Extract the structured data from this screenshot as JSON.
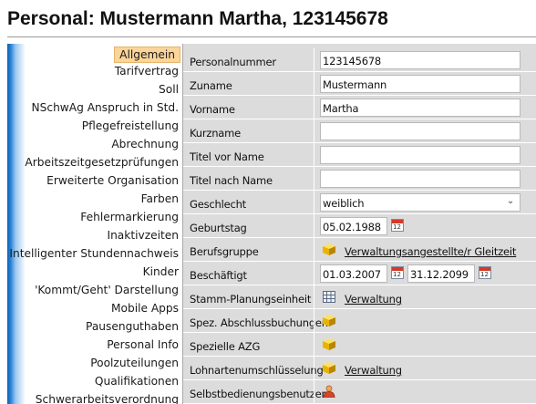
{
  "window": {
    "title": "Personal: Mustermann Martha, 123145678"
  },
  "sidebar": {
    "items": [
      {
        "label": "Allgemein",
        "active": true
      },
      {
        "label": "Tarifvertrag"
      },
      {
        "label": "Soll"
      },
      {
        "label": "NSchwAg Anspruch in Std."
      },
      {
        "label": "Pflegefreistellung"
      },
      {
        "label": "Abrechnung"
      },
      {
        "label": "Arbeitszeitgesetzprüfungen"
      },
      {
        "label": "Erweiterte Organisation"
      },
      {
        "label": "Farben"
      },
      {
        "label": "Fehlermarkierung"
      },
      {
        "label": "Inaktivzeiten"
      },
      {
        "label": "Intelligenter Stundennachweis"
      },
      {
        "label": "Kinder"
      },
      {
        "label": "'Kommt/Geht' Darstellung"
      },
      {
        "label": "Mobile Apps"
      },
      {
        "label": "Pausenguthaben"
      },
      {
        "label": "Personal Info"
      },
      {
        "label": "Poolzuteilungen"
      },
      {
        "label": "Qualifikationen"
      },
      {
        "label": "Schwerarbeitsverordnung"
      }
    ]
  },
  "form": {
    "personalnummer": {
      "label": "Personalnummer",
      "value": "123145678"
    },
    "zuname": {
      "label": "Zuname",
      "value": "Mustermann"
    },
    "vorname": {
      "label": "Vorname",
      "value": "Martha"
    },
    "kurzname": {
      "label": "Kurzname",
      "value": ""
    },
    "titel_vor": {
      "label": "Titel vor Name",
      "value": ""
    },
    "titel_nach": {
      "label": "Titel nach Name",
      "value": ""
    },
    "geschlecht": {
      "label": "Geschlecht",
      "value": "weiblich"
    },
    "geburtstag": {
      "label": "Geburtstag",
      "value": "05.02.1988"
    },
    "berufsgruppe": {
      "label": "Berufsgruppe",
      "link": "Verwaltungsangestellte/r Gleitzeit"
    },
    "beschaeftigt": {
      "label": "Beschäftigt",
      "from": "01.03.2007",
      "to": "31.12.2099"
    },
    "stamm_planungseinheit": {
      "label": "Stamm-Planungseinheit",
      "link": "Verwaltung"
    },
    "spez_abschlussbuchungen": {
      "label": "Spez. Abschlussbuchungen"
    },
    "spezielle_azg": {
      "label": "Spezielle AZG"
    },
    "lohnartenumschluesselung": {
      "label": "Lohnartenumschlüsselung",
      "link": "Verwaltung"
    },
    "selbstbedienungsbenutzer": {
      "label": "Selbstbedienungsbenutzer"
    }
  },
  "icons": {
    "calendar": "calendar-icon",
    "cube": "cube-icon",
    "grid": "grid-icon",
    "user": "user-icon",
    "dropdown": "chevron-down-icon"
  },
  "colors": {
    "sidebar_accent": "#0c5fb8",
    "active_item_bg": "#fbd49a",
    "form_bg": "#dcdcdc",
    "calendar_red": "#d23a2a",
    "cube_yellow": "#e8b400"
  }
}
